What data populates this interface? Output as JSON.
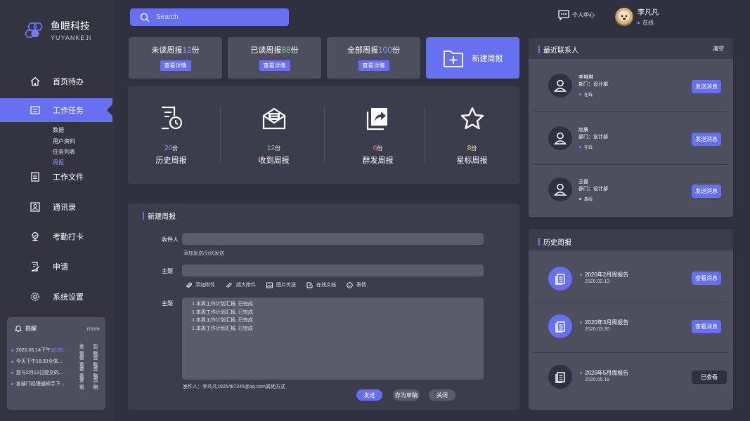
{
  "brand": {
    "name": "鱼眼科技",
    "sub": "YUYANKEJI"
  },
  "search": {
    "placeholder": "Search"
  },
  "header": {
    "center_link": "个人中心",
    "user_name": "李凡凡",
    "user_status": "在线"
  },
  "nav": {
    "items": [
      {
        "label": "首页待办",
        "icon": "home-icon"
      },
      {
        "label": "工作任务",
        "icon": "task-icon"
      },
      {
        "label": "工作文件",
        "icon": "file-icon"
      },
      {
        "label": "通讯录",
        "icon": "contacts-icon"
      },
      {
        "label": "考勤打卡",
        "icon": "clock-in-icon"
      },
      {
        "label": "申请",
        "icon": "apply-icon"
      },
      {
        "label": "系统设置",
        "icon": "settings-icon"
      }
    ],
    "sub_items": [
      "数据",
      "用户资料",
      "任务列表",
      "周报"
    ]
  },
  "reminder": {
    "title": "提醒",
    "more": "more",
    "rows": [
      {
        "text": "2020.05.14下午",
        "time": "18:00...",
        "a1": "查看",
        "a2": "忽略"
      },
      {
        "text": "今天下午16:30全体...",
        "time": "",
        "a1": "查看",
        "a2": "忽略"
      },
      {
        "text": "您与2月12日提交的...",
        "time": "",
        "a1": "查看",
        "a2": "忽略"
      },
      {
        "text": "各部门经理通知手下...",
        "time": "",
        "a1": "查看",
        "a2": "忽略"
      }
    ]
  },
  "stats": {
    "cards": [
      {
        "prefix": "未读周报",
        "num": "12",
        "unit": "份",
        "btn": "查看详情"
      },
      {
        "prefix": "已读周报",
        "num": "88",
        "unit": "份",
        "btn": "查看详情"
      },
      {
        "prefix": "全部周报",
        "num": "100",
        "unit": "份",
        "btn": "查看详情"
      }
    ],
    "new_label": "新建周报"
  },
  "summary": {
    "items": [
      {
        "num": "20",
        "unit": "份",
        "label": "历史周报",
        "color": "#8f97ff",
        "icon": "history-report-icon"
      },
      {
        "num": "12",
        "unit": "份",
        "label": "收到周报",
        "color": "#7ad88f",
        "icon": "inbox-mail-icon"
      },
      {
        "num": "6",
        "unit": "份",
        "label": "群发周报",
        "color": "#ff6b6b",
        "icon": "share-icon"
      },
      {
        "num": "8",
        "unit": "份",
        "label": "星标周报",
        "color": "#f2c94c",
        "icon": "star-icon"
      }
    ]
  },
  "compose": {
    "title": "新建周报",
    "recipient_label": "收件人",
    "recipient_hint": "添加发送/分别发送",
    "subject_label": "主题",
    "body_label": "主题",
    "tools": [
      "添加附件",
      "超大附件",
      "图片传送",
      "在线文档",
      "表情"
    ],
    "body_lines": [
      "1.本周工作计划汇报, 已完成",
      "1.本周工作计划汇报, 已完成",
      "1.本周工作计划汇报, 已完成",
      "1.本周工作计划汇报, 已完成"
    ],
    "sender": "发件人：李凡凡1925487245@qq.com",
    "other": "其他方式",
    "send": "发送",
    "draft": "存为草稿",
    "close": "关闭"
  },
  "contacts": {
    "title": "最近联系人",
    "clear": "清空",
    "items": [
      {
        "name": "李琳琳",
        "dept": "部门：设计部",
        "status": "在线",
        "btn": "发送消息",
        "dot": "#7b84ff"
      },
      {
        "name": "赵晨",
        "dept": "部门：设计部",
        "status": "在线",
        "btn": "发送消息",
        "dot": "#7b84ff"
      },
      {
        "name": "王磊",
        "dept": "部门：设计部",
        "status": "离线",
        "btn": "发送消息",
        "dot": "#cfcfd6"
      }
    ]
  },
  "history": {
    "title": "历史周报",
    "items": [
      {
        "title": "2020年2月周报告",
        "date": "2020.02.13",
        "btn": "查看消息"
      },
      {
        "title": "2020年3月周报告",
        "date": "2020.03.30",
        "btn": "查看消息"
      },
      {
        "title": "2020年5月周报告",
        "date": "2020.05.19",
        "btn": "已查看"
      }
    ]
  }
}
